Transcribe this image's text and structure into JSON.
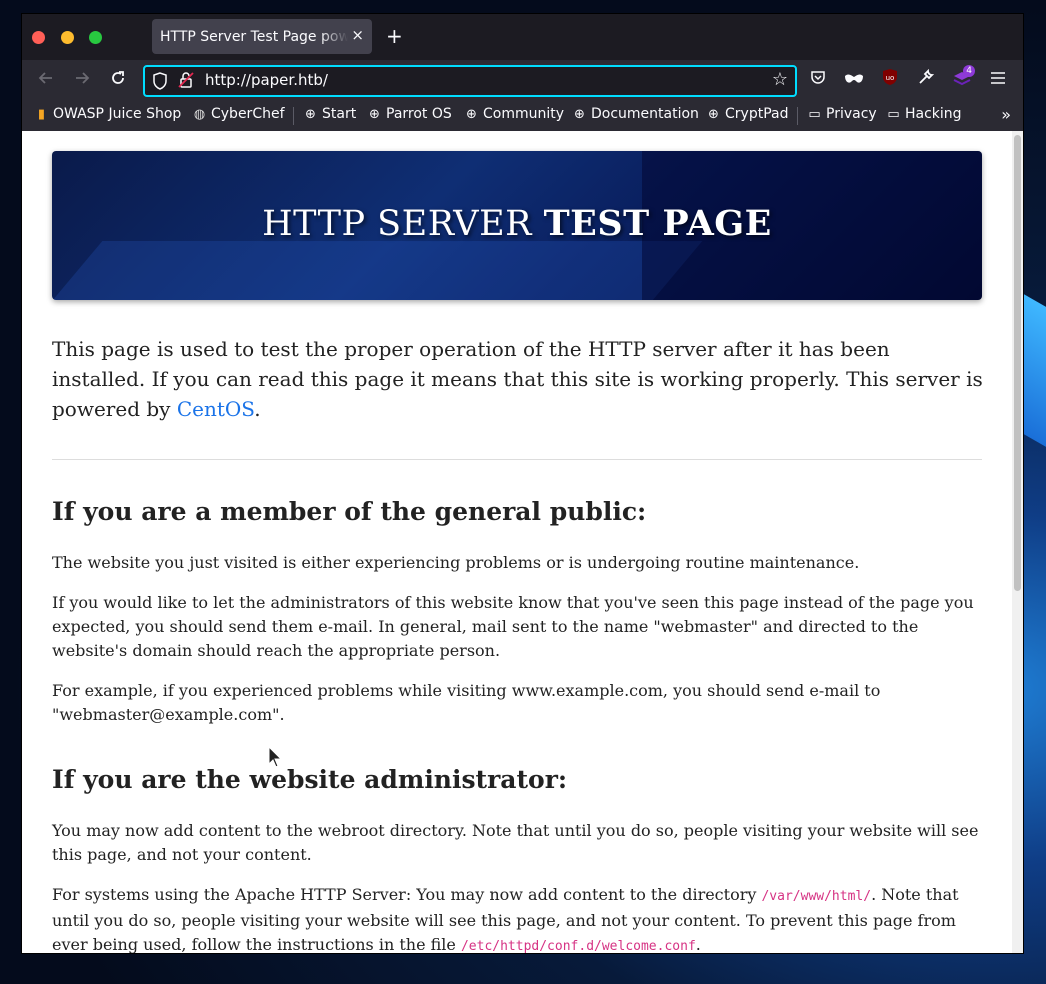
{
  "browser": {
    "tab_title": "HTTP Server Test Page powered by CentOS",
    "tab_close": "×",
    "new_tab": "+",
    "url": "http://paper.htb/",
    "accent_color": "#00ddff"
  },
  "bookmarks": [
    {
      "label": "OWASP Juice Shop",
      "icon": "juice-icon"
    },
    {
      "label": "CyberChef",
      "icon": "chef-icon"
    },
    {
      "label": "Start",
      "icon": "globe-icon"
    },
    {
      "label": "Parrot OS",
      "icon": "globe-icon"
    },
    {
      "label": "Community",
      "icon": "globe-icon"
    },
    {
      "label": "Documentation",
      "icon": "globe-icon"
    },
    {
      "label": "CryptPad",
      "icon": "globe-icon"
    },
    {
      "label": "Privacy",
      "icon": "folder-icon"
    },
    {
      "label": "Hacking",
      "icon": "folder-icon"
    }
  ],
  "extensions": {
    "notification_badge": "4"
  },
  "page": {
    "hero_title_normal": "HTTP SERVER",
    "hero_title_bold": "TEST PAGE",
    "intro_text": "This page is used to test the proper operation of the HTTP server after it has been installed. If you can read this page it means that this site is working properly. This server is powered by ",
    "intro_link": "CentOS",
    "intro_end": ".",
    "public_heading": "If you are a member of the general public:",
    "public_p1": "The website you just visited is either experiencing problems or is undergoing routine maintenance.",
    "public_p2": "If you would like to let the administrators of this website know that you've seen this page instead of the page you expected, you should send them e-mail. In general, mail sent to the name \"webmaster\" and directed to the website's domain should reach the appropriate person.",
    "public_p3": "For example, if you experienced problems while visiting www.example.com, you should send e-mail to \"webmaster@example.com\".",
    "admin_heading": "If you are the website administrator:",
    "admin_p1": "You may now add content to the webroot directory. Note that until you do so, people visiting your website will see this page, and not your content.",
    "admin_p2_a": "For systems using the Apache HTTP Server: You may now add content to the directory ",
    "admin_p2_code1": "/var/www/html/",
    "admin_p2_b": ". Note that until you do so, people visiting your website will see this page, and not your content. To prevent this page from ever being used, follow the instructions in the file ",
    "admin_p2_code2": "/etc/httpd/conf.d/welcome.conf",
    "admin_p2_c": "."
  }
}
